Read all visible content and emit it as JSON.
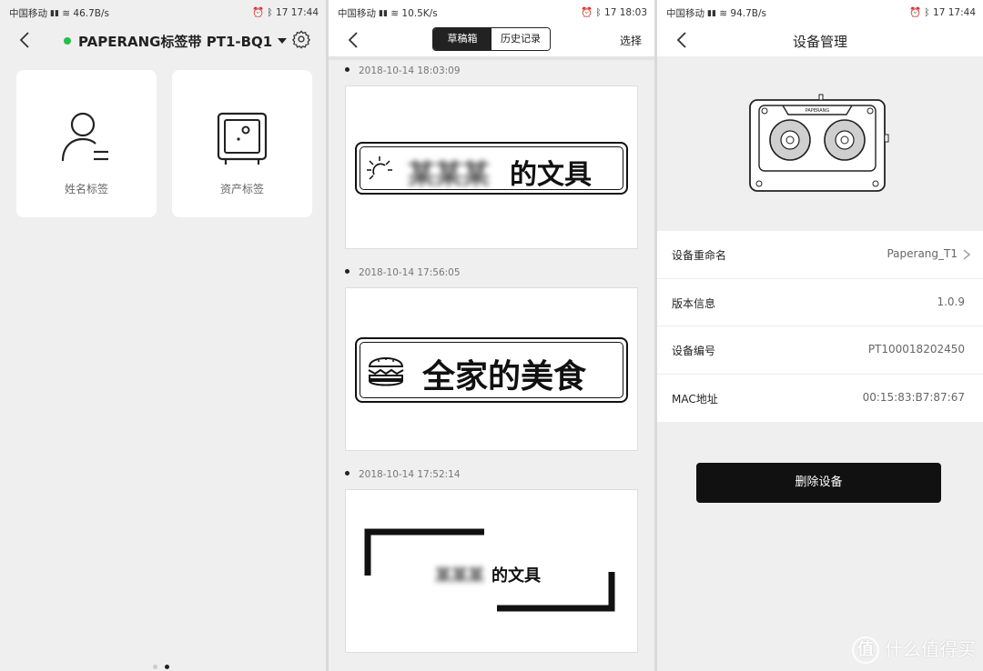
{
  "panel1": {
    "status": {
      "carrier": "中国移动",
      "speed": "46.7B/s",
      "battery": "17",
      "time": "17:44"
    },
    "title": "PAPERANG标签带 PT1-BQ1",
    "status_color": "#22c04a",
    "cards": [
      {
        "label": "姓名标签",
        "icon": "person-icon"
      },
      {
        "label": "资产标签",
        "icon": "safe-icon"
      }
    ],
    "page_dots": {
      "count": 2,
      "active": 2
    }
  },
  "panel2": {
    "status": {
      "carrier": "中国移动",
      "speed": "10.5K/s",
      "battery": "17",
      "time": "18:03"
    },
    "tabs": [
      {
        "label": "草稿箱",
        "selected": true
      },
      {
        "label": "历史记录",
        "selected": false
      }
    ],
    "select_label": "选择",
    "entries": [
      {
        "date": "2018-10-14 18:03:09",
        "text_blurred": "某某某",
        "text": "的文具"
      },
      {
        "date": "2018-10-14 17:56:05",
        "text": "全家的美食"
      },
      {
        "date": "2018-10-14 17:52:14",
        "text_blurred": "某某某",
        "text": "的文具"
      }
    ]
  },
  "panel3": {
    "status": {
      "carrier": "中国移动",
      "speed": "94.7B/s",
      "battery": "17",
      "time": "17:44"
    },
    "title": "设备管理",
    "device_brand": "PAPERANG",
    "rows": [
      {
        "key": "设备重命名",
        "value": "Paperang_T1",
        "chevron": true
      },
      {
        "key": "版本信息",
        "value": "1.0.9"
      },
      {
        "key": "设备编号",
        "value": "PT100018202450"
      },
      {
        "key": "MAC地址",
        "value": "00:15:83:B7:87:67"
      }
    ],
    "delete_label": "删除设备"
  },
  "watermark": {
    "circle": "值",
    "text": "什么值得买"
  }
}
